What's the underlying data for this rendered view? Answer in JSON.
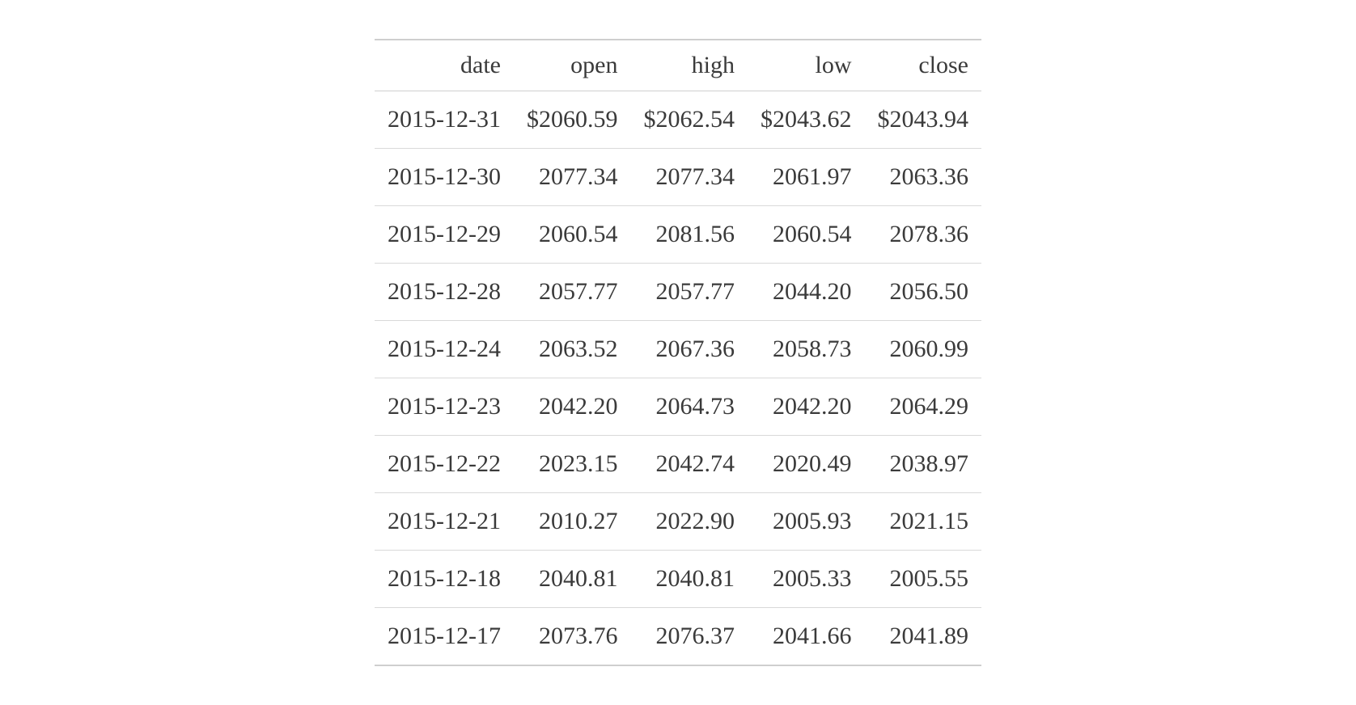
{
  "chart_data": {
    "type": "table",
    "columns": [
      "date",
      "open",
      "high",
      "low",
      "close"
    ],
    "rows": [
      {
        "date": "2015-12-31",
        "open": "$2060.59",
        "high": "$2062.54",
        "low": "$2043.62",
        "close": "$2043.94"
      },
      {
        "date": "2015-12-30",
        "open": "2077.34",
        "high": "2077.34",
        "low": "2061.97",
        "close": "2063.36"
      },
      {
        "date": "2015-12-29",
        "open": "2060.54",
        "high": "2081.56",
        "low": "2060.54",
        "close": "2078.36"
      },
      {
        "date": "2015-12-28",
        "open": "2057.77",
        "high": "2057.77",
        "low": "2044.20",
        "close": "2056.50"
      },
      {
        "date": "2015-12-24",
        "open": "2063.52",
        "high": "2067.36",
        "low": "2058.73",
        "close": "2060.99"
      },
      {
        "date": "2015-12-23",
        "open": "2042.20",
        "high": "2064.73",
        "low": "2042.20",
        "close": "2064.29"
      },
      {
        "date": "2015-12-22",
        "open": "2023.15",
        "high": "2042.74",
        "low": "2020.49",
        "close": "2038.97"
      },
      {
        "date": "2015-12-21",
        "open": "2010.27",
        "high": "2022.90",
        "low": "2005.93",
        "close": "2021.15"
      },
      {
        "date": "2015-12-18",
        "open": "2040.81",
        "high": "2040.81",
        "low": "2005.33",
        "close": "2005.55"
      },
      {
        "date": "2015-12-17",
        "open": "2073.76",
        "high": "2076.37",
        "low": "2041.66",
        "close": "2041.89"
      }
    ]
  }
}
